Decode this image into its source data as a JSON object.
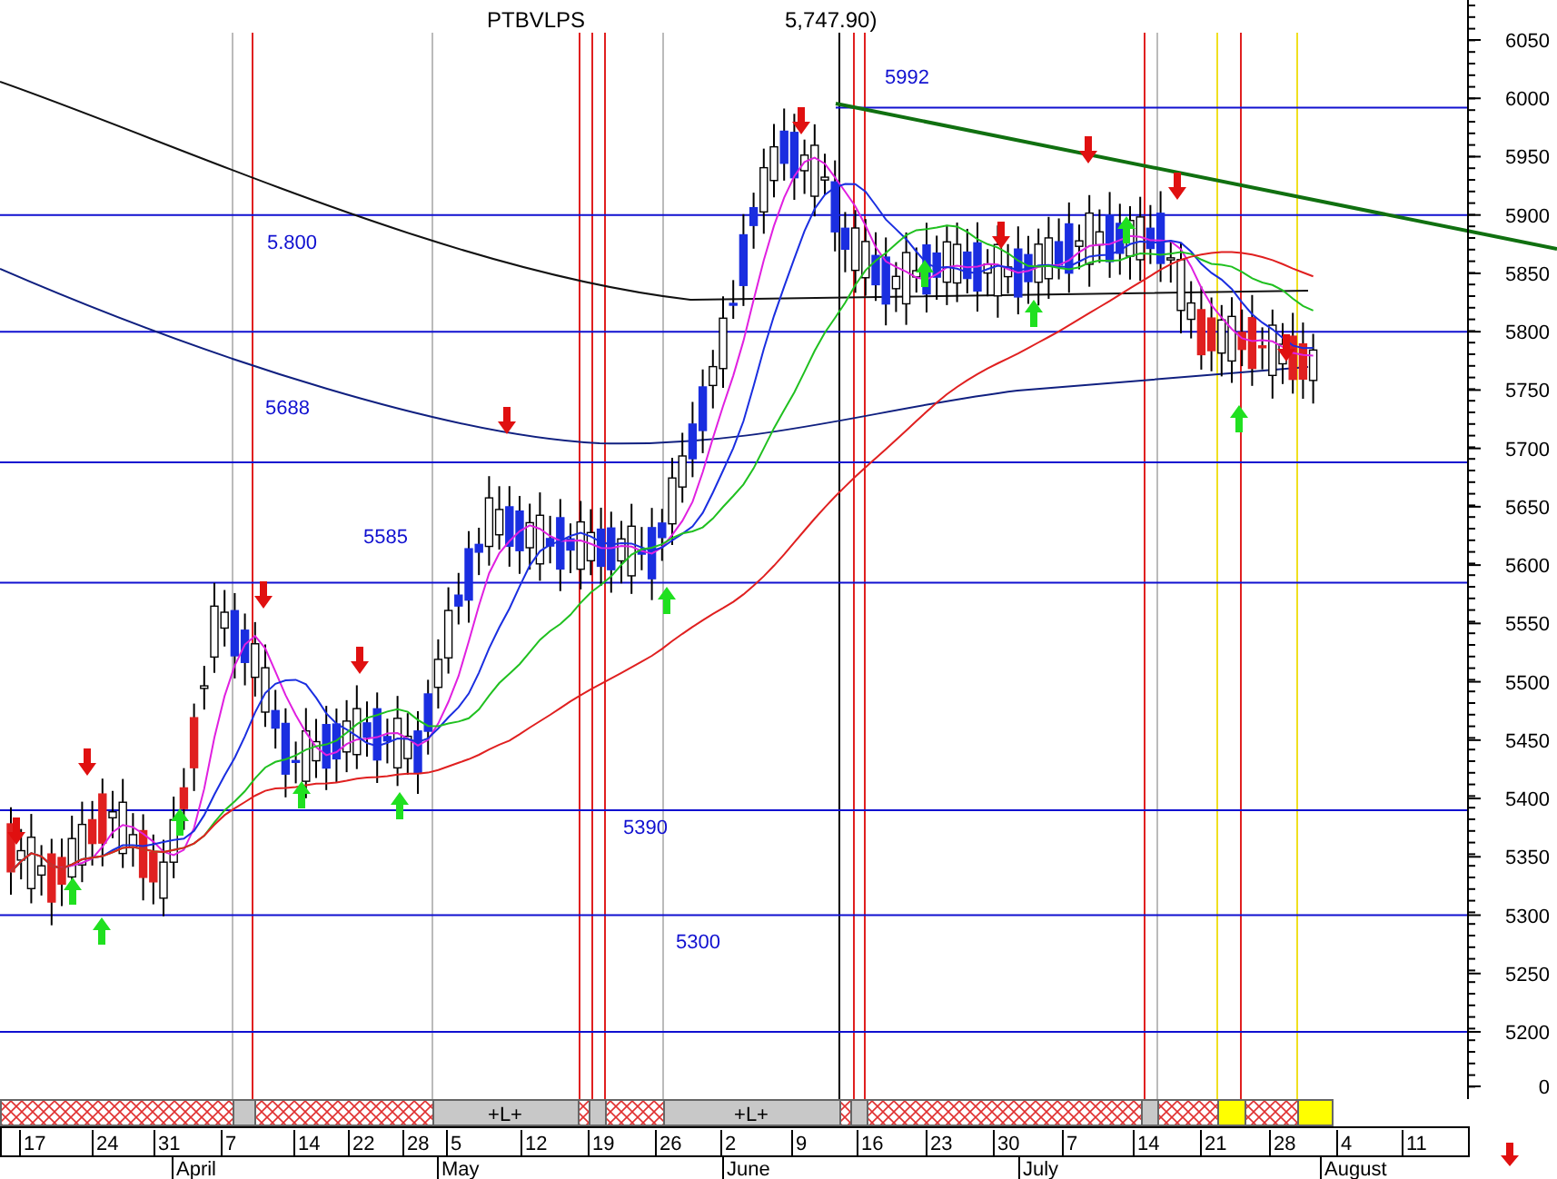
{
  "chart": {
    "title": "PTBVLPS",
    "title_value": "5,747.90)",
    "y_ticks": [
      "6050",
      "6000",
      "5950",
      "5900",
      "5850",
      "5800",
      "5750",
      "5700",
      "5650",
      "5600",
      "5550",
      "5500",
      "5450",
      "5400",
      "5350",
      "5300",
      "5250",
      "5200",
      "0"
    ],
    "level_labels": [
      {
        "label": "5992"
      },
      {
        "label": "5.800"
      },
      {
        "label": "5688"
      },
      {
        "label": "5585"
      },
      {
        "label": "5390"
      },
      {
        "label": "5300"
      }
    ],
    "period_strip": [
      {
        "kind": "hatched"
      },
      {
        "kind": "gray"
      },
      {
        "kind": "hatched"
      },
      {
        "kind": "gray",
        "label": "+L+"
      },
      {
        "kind": "hatched"
      },
      {
        "kind": "gray"
      },
      {
        "kind": "hatched"
      },
      {
        "kind": "gray",
        "label": "+L+"
      },
      {
        "kind": "hatched"
      },
      {
        "kind": "gray"
      },
      {
        "kind": "hatched"
      },
      {
        "kind": "gray"
      },
      {
        "kind": "hatched"
      },
      {
        "kind": "yellow"
      },
      {
        "kind": "hatched"
      },
      {
        "kind": "yellow"
      }
    ],
    "days": [
      "17",
      "24",
      "31",
      "7",
      "14",
      "22",
      "28",
      "5",
      "12",
      "19",
      "26",
      "2",
      "9",
      "16",
      "23",
      "30",
      "7",
      "14",
      "21",
      "28",
      "4",
      "11"
    ],
    "months": [
      "April",
      "May",
      "June",
      "July",
      "August"
    ]
  }
}
